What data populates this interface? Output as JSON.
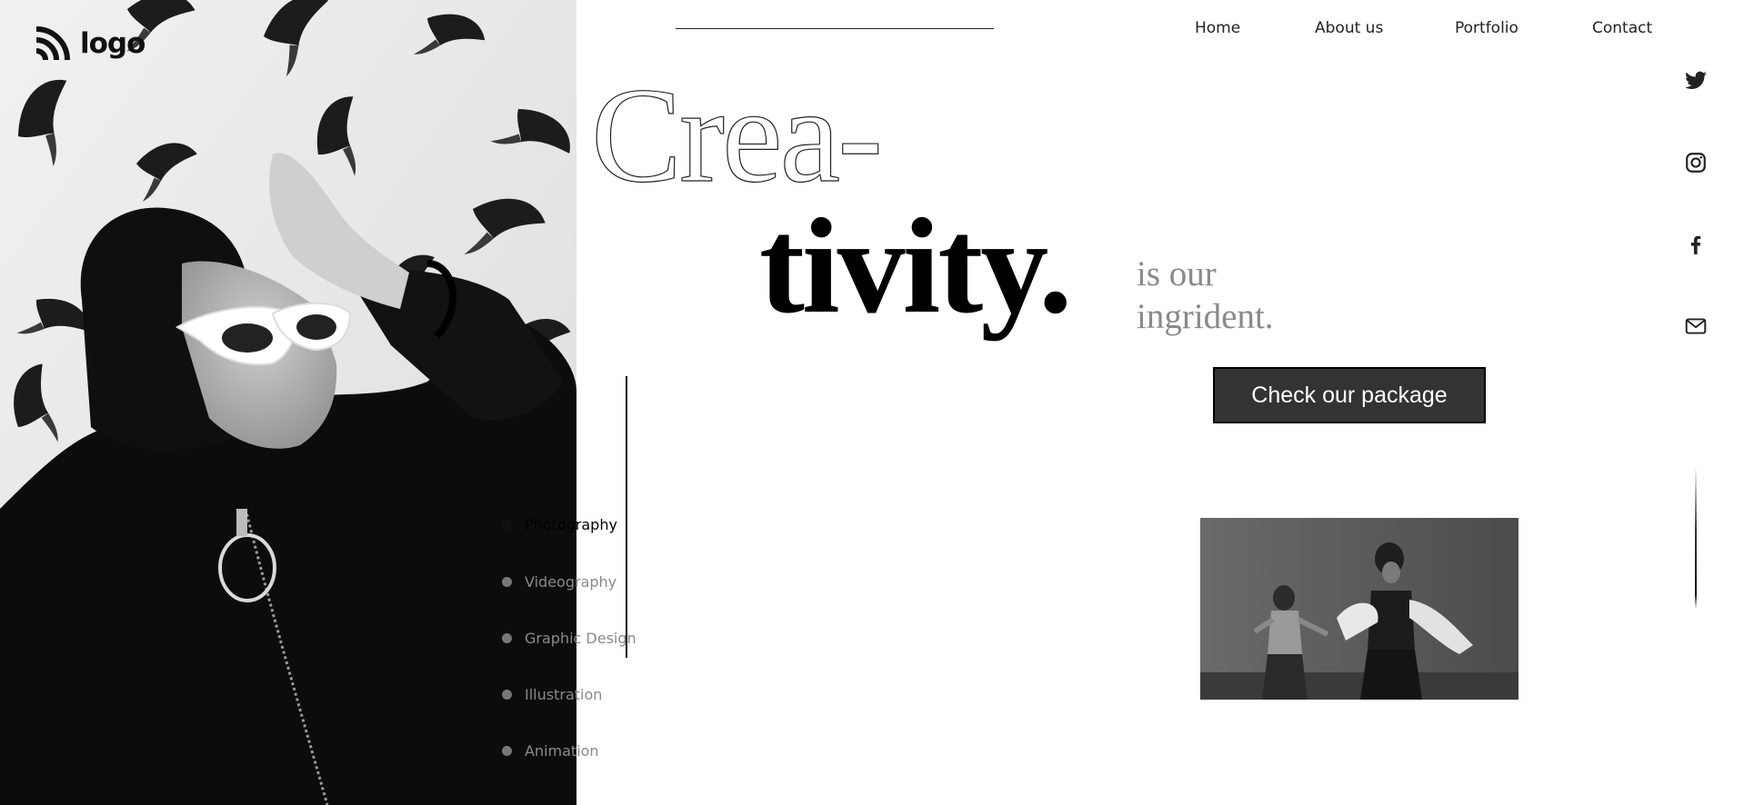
{
  "logo": {
    "text": "logo",
    "icon": "rss-like-logo-icon"
  },
  "nav": {
    "items": [
      {
        "label": "Home"
      },
      {
        "label": "About us"
      },
      {
        "label": "Portfolio"
      },
      {
        "label": "Contact"
      }
    ]
  },
  "hero": {
    "headline_top": "Crea-",
    "headline_bottom": "tivity.",
    "tagline_line1": "is our",
    "tagline_line2": "ingrident.",
    "cta_label": "Check our package"
  },
  "services": {
    "items": [
      {
        "label": "Photography",
        "active": true
      },
      {
        "label": "Videography",
        "active": false
      },
      {
        "label": "Graphic Design",
        "active": false
      },
      {
        "label": "Illustration",
        "active": false
      },
      {
        "label": "Animation",
        "active": false
      }
    ]
  },
  "social": {
    "icons": [
      "twitter-icon",
      "instagram-icon",
      "facebook-icon",
      "mail-icon"
    ]
  },
  "colors": {
    "text": "#222222",
    "muted": "#8a8a8a",
    "button_bg": "#333333",
    "button_text": "#ffffff"
  }
}
